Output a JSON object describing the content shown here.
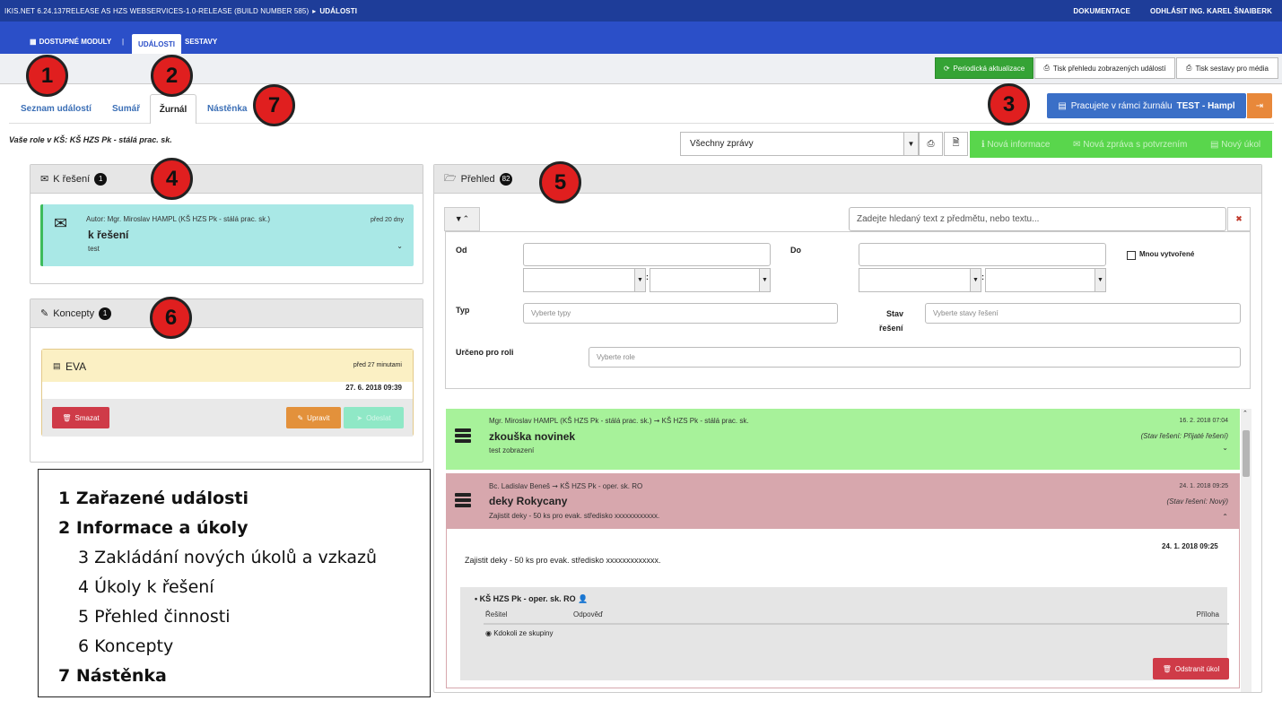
{
  "topbar": {
    "build": "IKIS.NET 6.24.137RELEASE AS HZS WEBSERVICES-1.0-RELEASE (BUILD NUMBER 585)",
    "sep": "▸",
    "section": "UDÁLOSTI",
    "doc": "DOKUMENTACE",
    "logout": "ODHLÁSIT ING. KAREL ŠNAIBERK"
  },
  "nav": {
    "modules": "DOSTUPNÉ MODULY",
    "sep": "|",
    "events": "UDÁLOSTI",
    "reports": "SESTAVY"
  },
  "toolbar": {
    "refresh": "Periodická aktualizace",
    "print_overview": "Tisk přehledu zobrazených událostí",
    "print_media": "Tisk sestavy pro média"
  },
  "tabs": {
    "list": "Seznam událostí",
    "summary": "Sumář",
    "journal": "Žurnál",
    "board": "Nástěnka"
  },
  "journal": {
    "prefix": "Pracujete v rámci žurnálu",
    "name": "TEST - Hampl"
  },
  "role": "Vaše role v KŠ: KŠ HZS Pk - stálá prac. sk.",
  "filter_select": "Všechny zprávy",
  "green_actions": {
    "new_info": "Nová informace",
    "new_msg": "Nová zpráva s potvrzením",
    "new_task": "Nový úkol"
  },
  "k_reseni": {
    "title": "K řešení",
    "count": "1",
    "card": {
      "author": "Autor: Mgr. Miroslav HAMPL (KŠ HZS Pk - stálá prac. sk.)",
      "ago": "před 20 dny",
      "title": "k řešení",
      "text": "test",
      "chevron": "⌄"
    }
  },
  "koncepty": {
    "title": "Koncepty",
    "count": "1",
    "card": {
      "name": "EVA",
      "ago": "před 27 minutami",
      "date": "27. 6. 2018 09:39",
      "delete": "Smazat",
      "edit": "Upravit",
      "send": "Odeslat"
    }
  },
  "prehled": {
    "title": "Přehled",
    "count": "82",
    "search_placeholder": "Zadejte hledaný text z předmětu, nebo textu...",
    "clear": "✖",
    "filter_toggle": "▼⌃",
    "form": {
      "from": "Od",
      "to": "Do",
      "colon": ":",
      "mine": "Mnou vytvořené",
      "type": "Typ",
      "type_ph": "Vyberte typy",
      "state1": "Stav",
      "state2": "řešení",
      "state_ph": "Vyberte stavy řešení",
      "role": "Určeno pro roli",
      "role_ph": "Vyberte role"
    },
    "items": [
      {
        "route": "Mgr. Miroslav HAMPL (KŠ HZS Pk - stálá prac. sk.) ➞ KŠ HZS Pk - stálá prac. sk.",
        "date": "16. 2. 2018 07:04",
        "title": "zkouška novinek",
        "state": "(Stav řešení: Přijaté řešení)",
        "text": "test zobrazení",
        "chevron": "⌄"
      },
      {
        "route": "Bc. Ladislav Beneš ➞ KŠ HZS Pk - oper. sk. RO",
        "date": "24. 1. 2018 09:25",
        "title": "deky Rokycany",
        "state": "(Stav řešení: Nový)",
        "text": "Zajistit deky - 50 ks pro evak. středisko xxxxxxxxxxxx.",
        "chevron": "⌃",
        "detail": {
          "date": "24. 1. 2018 09:25",
          "text": "Zajistit deky - 50 ks pro evak. středisko xxxxxxxxxxxxx.",
          "group": "• KŠ HZS Pk - oper. sk. RO",
          "col_solver": "Řešitel",
          "col_answer": "Odpověď",
          "col_attach": "Příloha",
          "anyone": "Kdokoli ze skupiny",
          "remove": "Odstranit úkol"
        }
      }
    ]
  },
  "callouts": [
    "1",
    "2",
    "3",
    "4",
    "5",
    "6",
    "7"
  ],
  "legend": [
    "1 Zařazené události",
    "2 Informace a úkoly",
    "3 Zakládání nových úkolů a vzkazů",
    "4 Úkoly k řešení",
    "5 Přehled činnosti",
    "6 Koncepty",
    "7 Nástěnka"
  ],
  "colors": {
    "topbar": "#1e3d99",
    "nav": "#2b4fc8",
    "accent_green": "#59d64c",
    "callout": "#e01f1f",
    "card_teal": "#a9e8e6",
    "row_green": "#a7f29a",
    "row_red": "#d7a7ad"
  }
}
